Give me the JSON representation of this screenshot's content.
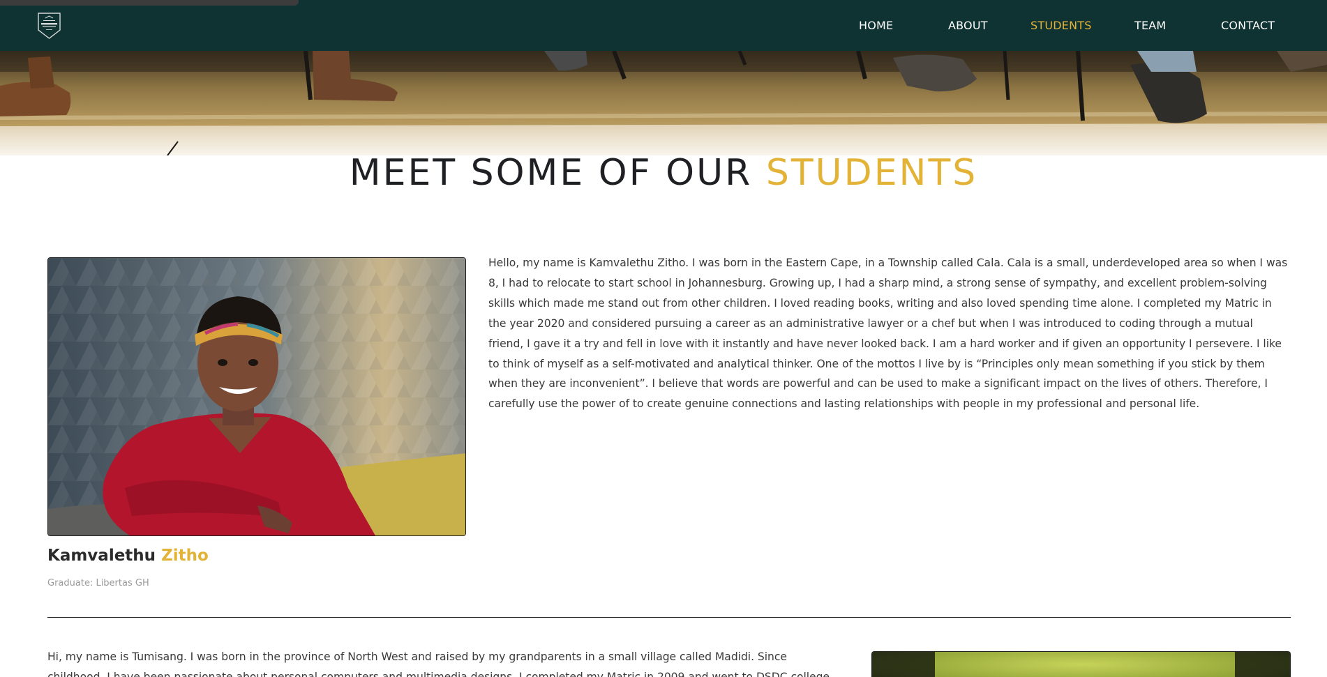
{
  "nav": {
    "logo_alt": "The Coding Commune logo",
    "links": [
      {
        "label": "HOME",
        "active": false
      },
      {
        "label": "ABOUT",
        "active": false
      },
      {
        "label": "STUDENTS",
        "active": true
      },
      {
        "label": "TEAM",
        "active": false
      },
      {
        "label": "CONTACT",
        "active": false
      }
    ]
  },
  "heading": {
    "main": "MEET SOME OF OUR",
    "accent": "STUDENTS"
  },
  "students": [
    {
      "first_name": "Kamvalethu",
      "last_name": "Zitho",
      "graduate": "Graduate: Libertas GH",
      "bio": "Hello, my name is Kamvalethu Zitho. I was born in the Eastern Cape, in a Township called Cala. Cala is a small, underdeveloped area so when I was 8, I had to relocate to start school in Johannesburg. Growing up, I had a sharp mind, a strong sense of sympathy, and excellent problem-solving skills which made me stand out from other children. I loved reading books, writing and also loved spending time alone. I completed my Matric in the year 2020 and considered pursuing a career as an administrative lawyer or a chef but when I was introduced to coding through a mutual friend, I gave it a try and fell in love with it instantly and have never looked back. I am a hard worker and if given an opportunity I persevere. I like to think of myself as a self-motivated and analytical thinker. One of the mottos I live by is “Principles only mean something if you stick by them when they are inconvenient”. I believe that words are powerful and can be used to make a significant impact on the lives of others. Therefore, I carefully use the power of to create genuine connections and lasting relationships with people in my professional and personal life."
    },
    {
      "bio_visible": "Hi, my name is Tumisang. I was born in the province of North West and raised by my grandparents in a small village called Madidi. Since childhood, I have been passionate about personal computers and multimedia designs. I completed my Matric in 2009 and went to DSDC college the following year for a"
    }
  ],
  "colors": {
    "nav_bg": "#0e3332",
    "accent": "#e3b338",
    "text": "#3a3a3a",
    "muted": "#9a9a9a"
  }
}
